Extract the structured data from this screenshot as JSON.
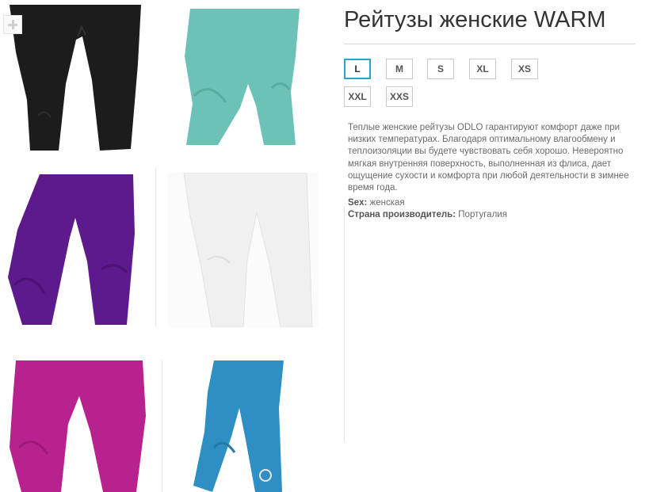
{
  "product": {
    "title": "Рейтузы женские WARM",
    "description": "Теплые женские рейтузы ODLO гарантируют комфорт даже при низких температурах. Благодаря оптимальному влагообмену и теплоизоляции вы будете чувствовать себя хорошо. Невероятно мягкая внутренняя поверхность, выполненная из флиса, дает ощущение сухости и комфорта при любой деятельности в зимнее время года.",
    "properties": [
      {
        "label": "Sex:",
        "value": "женская"
      },
      {
        "label": "Страна производитель:",
        "value": "Португалия"
      }
    ]
  },
  "sizes": [
    {
      "label": "L",
      "selected": true
    },
    {
      "label": "M",
      "selected": false
    },
    {
      "label": "S",
      "selected": false
    },
    {
      "label": "XL",
      "selected": false
    },
    {
      "label": "XS",
      "selected": false
    },
    {
      "label": "XXL",
      "selected": false
    },
    {
      "label": "XXS",
      "selected": false
    }
  ],
  "gallery": {
    "zoom_icon": "plus-icon",
    "colors": [
      {
        "name": "black",
        "hex": "#1c1c1c"
      },
      {
        "name": "turquoise",
        "hex": "#6cc2b6"
      },
      {
        "name": "purple",
        "hex": "#5c1a8c"
      },
      {
        "name": "white",
        "hex": "#f2f2f2"
      },
      {
        "name": "magenta",
        "hex": "#b8228e"
      },
      {
        "name": "blue",
        "hex": "#2d8fc4"
      }
    ]
  },
  "colors": {
    "accent": "#2aa6c8",
    "title": "#333333",
    "text": "#6a6a6a"
  }
}
